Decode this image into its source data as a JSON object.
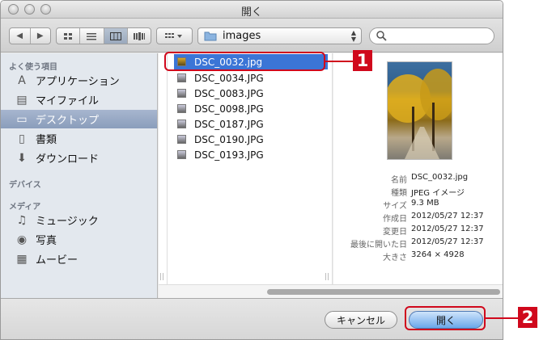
{
  "window": {
    "title": "開く"
  },
  "toolbar": {
    "location": "images",
    "search_placeholder": ""
  },
  "sidebar": {
    "favorites_title": "よく使う項目",
    "favorites": [
      {
        "label": "アプリケーション",
        "icon": "applications-icon"
      },
      {
        "label": "マイファイル",
        "icon": "all-files-icon"
      },
      {
        "label": "デスクトップ",
        "icon": "desktop-icon"
      },
      {
        "label": "書類",
        "icon": "documents-icon"
      },
      {
        "label": "ダウンロード",
        "icon": "downloads-icon"
      }
    ],
    "devices_title": "デバイス",
    "media_title": "メディア",
    "media": [
      {
        "label": "ミュージック",
        "icon": "music-icon"
      },
      {
        "label": "写真",
        "icon": "photos-icon"
      },
      {
        "label": "ムービー",
        "icon": "movies-icon"
      }
    ],
    "selected_index": 2
  },
  "files": [
    "DSC_0032.jpg",
    "DSC_0034.JPG",
    "DSC_0083.JPG",
    "DSC_0098.JPG",
    "DSC_0187.JPG",
    "DSC_0190.JPG",
    "DSC_0193.JPG"
  ],
  "selected_file_index": 0,
  "preview": {
    "rows": [
      {
        "key": "名前",
        "value": "DSC_0032.jpg"
      },
      {
        "key": "種類",
        "value": "JPEG イメージ"
      },
      {
        "key": "サイズ",
        "value": "9.3 MB"
      },
      {
        "key": "作成日",
        "value": "2012/05/27 12:37"
      },
      {
        "key": "変更日",
        "value": "2012/05/27 12:37"
      },
      {
        "key": "最後に開いた日",
        "value": "2012/05/27 12:37"
      },
      {
        "key": "大きさ",
        "value": "3264 × 4928"
      }
    ]
  },
  "buttons": {
    "cancel": "キャンセル",
    "open": "開く"
  },
  "callouts": {
    "one": "1",
    "two": "2"
  },
  "colors": {
    "accent": "#3b75d6",
    "callout": "#d0081c",
    "sidebar_bg": "#e3e8ee"
  }
}
